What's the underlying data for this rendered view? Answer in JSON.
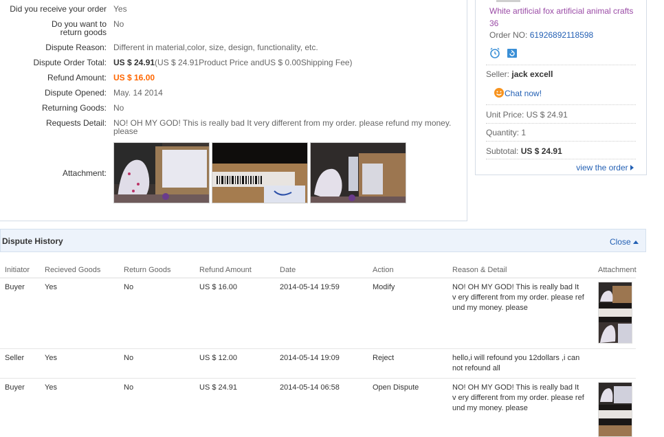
{
  "detail": {
    "received_label": "Did you receive your order",
    "received_value": "Yes",
    "return_label": "Do you want to return goods",
    "return_value": "No",
    "reason_label": "Dispute Reason:",
    "reason_value": "Different in material,color, size, design, functionality, etc.",
    "total_label": "Dispute Order Total:",
    "total_amount": "US $ 24.91",
    "total_breakdown": "(US $ 24.91Product Price andUS $ 0.00Shipping Fee)",
    "refund_label": "Refund Amount:",
    "refund_value": "US $ 16.00",
    "opened_label": "Dispute Opened:",
    "opened_value": "May. 14 2014",
    "returning_label": "Returning Goods:",
    "returning_value": "No",
    "requests_label": "Requests Detail:",
    "requests_value": "NO! OH MY GOD! This is really bad It very different from my order. please refund my money. please",
    "attachment_label": "Attachment:"
  },
  "order": {
    "product_title": "White artificial fox artificial animal crafts 36",
    "order_no_label": "Order NO:",
    "order_no": "61926892118598",
    "seller_label": "Seller:",
    "seller_name": "jack excell",
    "chat_label": "Chat now!",
    "unit_price_label": "Unit Price:",
    "unit_price": "US $ 24.91",
    "quantity_label": "Quantity:",
    "quantity": "1",
    "subtotal_label": "Subtotal:",
    "subtotal": "US $ 24.91",
    "view_order": "view the order"
  },
  "history": {
    "title": "Dispute History",
    "close_label": "Close",
    "columns": [
      "Initiator",
      "Recieved Goods",
      "Return Goods",
      "Refund Amount",
      "Date",
      "Action",
      "Reason & Detail",
      "Attachment"
    ],
    "rows": [
      {
        "initiator": "Buyer",
        "received": "Yes",
        "return": "No",
        "refund": "US $ 16.00",
        "date": "2014-05-14 19:59",
        "action": "Modify",
        "reason": "NO! OH MY GOD! This is really bad It v ery different from my order. please ref und my money. please"
      },
      {
        "initiator": "Seller",
        "received": "Yes",
        "return": "No",
        "refund": "US $ 12.00",
        "date": "2014-05-14 19:09",
        "action": "Reject",
        "reason": "hello,i will refound you 12dollars ,i can not refound all"
      },
      {
        "initiator": "Buyer",
        "received": "Yes",
        "return": "No",
        "refund": "US $ 24.91",
        "date": "2014-05-14 06:58",
        "action": "Open Dispute",
        "reason": "NO! OH MY GOD! This is really bad It v ery different from my order. please ref und my money. please"
      }
    ]
  },
  "icons": {
    "alarm": "alarm-clock-icon",
    "refresh": "refresh-icon",
    "chat": "smiley-chat-icon",
    "caret_right": "caret-right-icon",
    "caret_up": "caret-up-icon"
  },
  "colors": {
    "link": "#2360b4",
    "refund": "#ff6600",
    "product_title": "#9a4ba6",
    "header_bg": "#edf3fb"
  }
}
